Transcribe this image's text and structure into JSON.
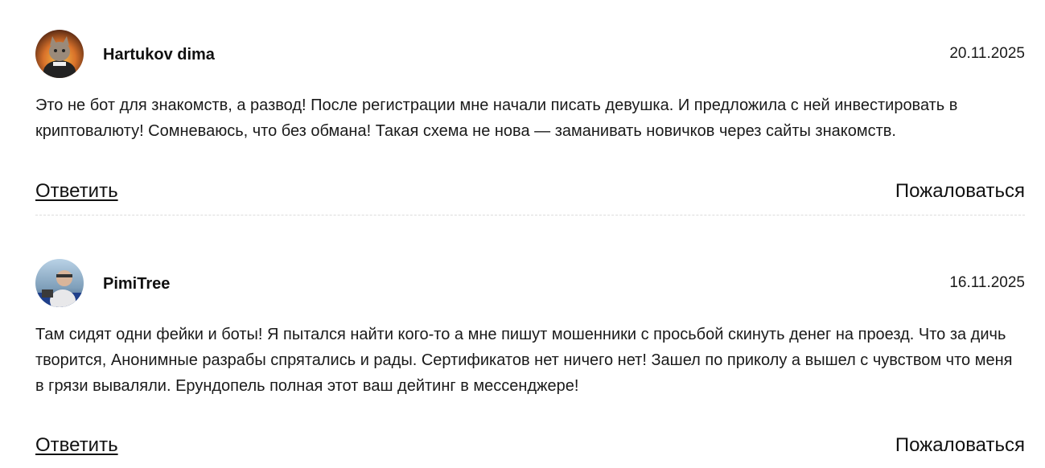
{
  "comments": [
    {
      "author": "Hartukov dima",
      "date": "20.11.2025",
      "text": "Это не бот для знакомств, а развод! После регистрации мне начали писать девушка. И предложила с ней инвестировать в криптовалюту! Сомневаюсь, что без обмана! Такая схема не нова — заманивать новичков через сайты знакомств.",
      "reply_label": "Ответить",
      "report_label": "Пожаловаться",
      "avatar_icon": "cat-avatar"
    },
    {
      "author": "PimiTree",
      "date": "16.11.2025",
      "text": "Там сидят одни фейки и боты! Я пытался найти кого-то а мне пишут мошенники с просьбой скинуть денег на проезд. Что за дичь творится, Анонимные разрабы спрятались и рады. Сертификатов нет ничего нет! Зашел по приколу а вышел с чувством что меня в грязи вываляли. Ерундопель полная этот ваш дейтинг в мессенджере!",
      "reply_label": "Ответить",
      "report_label": "Пожаловаться",
      "avatar_icon": "person-avatar"
    }
  ],
  "colors": {
    "text": "#1a1a1a",
    "divider": "#dcdcdc",
    "background": "#ffffff"
  }
}
